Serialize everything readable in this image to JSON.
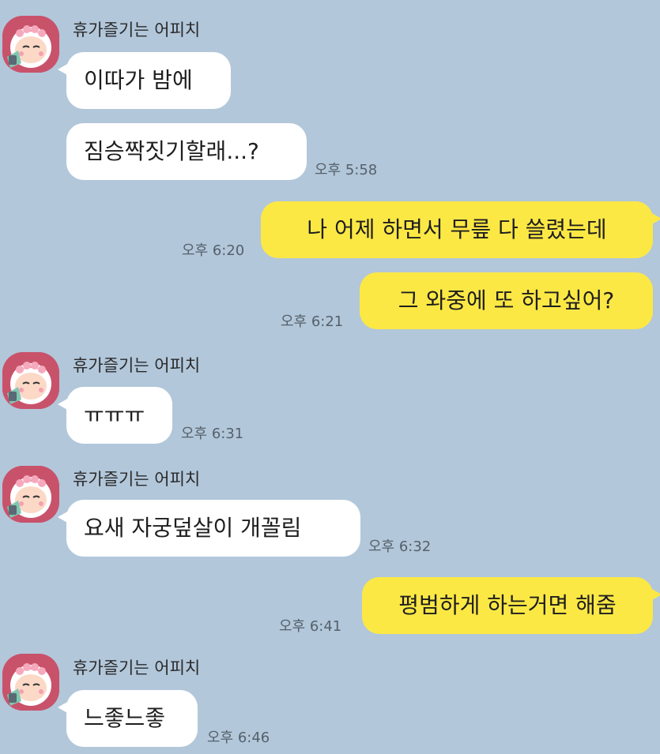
{
  "chat": {
    "sender_name": "휴가즐기는 어피치",
    "messages": [
      {
        "text": "이따가 밤에"
      },
      {
        "text": "짐승짝짓기할래...?",
        "time": "오후 5:58"
      },
      {
        "text": "나 어제 하면서 무릎 다 쓸렸는데",
        "time": "오후 6:20"
      },
      {
        "text": "그 와중에 또 하고싶어?",
        "time": "오후 6:21"
      },
      {
        "text": "ㅠㅠㅠ",
        "time": "오후 6:31"
      },
      {
        "text": "요새 자궁덮살이 개꼴림",
        "time": "오후 6:32"
      },
      {
        "text": "평범하게 하는거면 해줌",
        "time": "오후 6:41"
      },
      {
        "text": "느좋느좋",
        "time": "오후 6:46"
      }
    ]
  },
  "colors": {
    "background": "#b2c7da",
    "incoming_bubble": "#ffffff",
    "outgoing_bubble": "#fce845",
    "avatar_frame": "#c9526b"
  },
  "icons": {
    "avatar": "apeach-profile-icon"
  }
}
